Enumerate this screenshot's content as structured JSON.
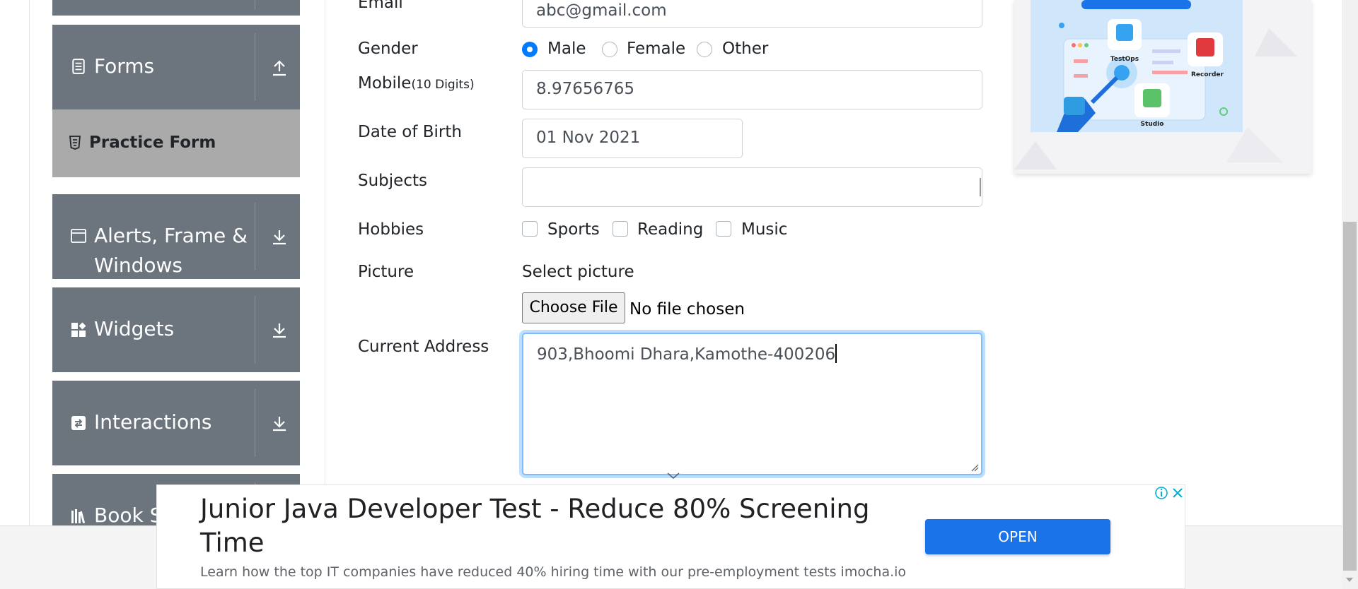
{
  "sidebar": {
    "groups": [
      {
        "label": "Forms"
      },
      {
        "label": "Alerts, Frame &",
        "label2": "Windows"
      },
      {
        "label": "Widgets"
      },
      {
        "label": "Interactions"
      },
      {
        "label": "Book Store Application"
      }
    ],
    "forms_items": [
      {
        "label": "Practice Form"
      }
    ]
  },
  "form": {
    "email": {
      "label": "Email",
      "value": "abc@gmail.com"
    },
    "gender": {
      "label": "Gender",
      "options": [
        "Male",
        "Female",
        "Other"
      ],
      "selected": "Male"
    },
    "mobile": {
      "label": "Mobile",
      "hint": "(10 Digits)",
      "value": "8.97656765"
    },
    "dob": {
      "label": "Date of Birth",
      "value": "01 Nov 2021"
    },
    "subjects": {
      "label": "Subjects",
      "value": ""
    },
    "hobbies": {
      "label": "Hobbies",
      "options": [
        "Sports",
        "Reading",
        "Music"
      ]
    },
    "picture": {
      "label": "Picture",
      "select_label": "Select picture",
      "button": "Choose File",
      "status": "No file chosen"
    },
    "address": {
      "label": "Current Address",
      "value": "903,Bhoomi Dhara,Kamothe-400206"
    }
  },
  "side_ad": {
    "labels": [
      "TestOps",
      "Recorder",
      "Studio"
    ]
  },
  "ad": {
    "title": "Junior Java Developer Test - Reduce 80% Screening Time",
    "description": "Learn how the top IT companies have reduced 40% hiring time with our pre-employment tests imocha.io",
    "button": "OPEN"
  },
  "colors": {
    "sidebar": "#6c757d",
    "active": "#aaaaaa",
    "accent": "#007bff",
    "ad_button": "#1a73e8"
  }
}
